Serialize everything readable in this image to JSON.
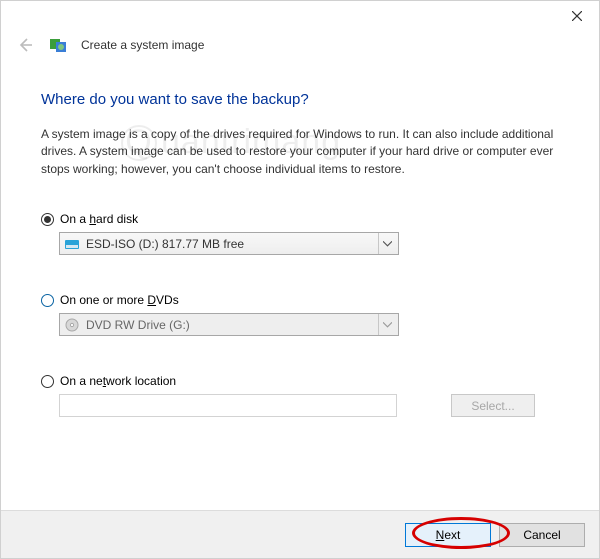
{
  "window": {
    "title": "Create a system image"
  },
  "page": {
    "heading": "Where do you want to save the backup?",
    "description": "A system image is a copy of the drives required for Windows to run. It can also include additional drives. A system image can be used to restore your computer if your hard drive or computer ever stops working; however, you can't choose individual items to restore."
  },
  "options": {
    "hard_disk": {
      "label_pre": "On a ",
      "label_key": "h",
      "label_post": "ard disk",
      "selected_value": "ESD-ISO (D:)  817.77 MB free",
      "checked": true
    },
    "dvd": {
      "label_pre": "On one or more ",
      "label_key": "D",
      "label_post": "VDs",
      "selected_value": "DVD RW Drive (G:)",
      "checked": false
    },
    "network": {
      "label_pre": "On a ne",
      "label_key": "t",
      "label_post": "work location",
      "value": "",
      "select_label": "Select...",
      "checked": false
    }
  },
  "footer": {
    "next_key": "N",
    "next_rest": "ext",
    "cancel": "Cancel"
  },
  "watermark": "uantrimang"
}
